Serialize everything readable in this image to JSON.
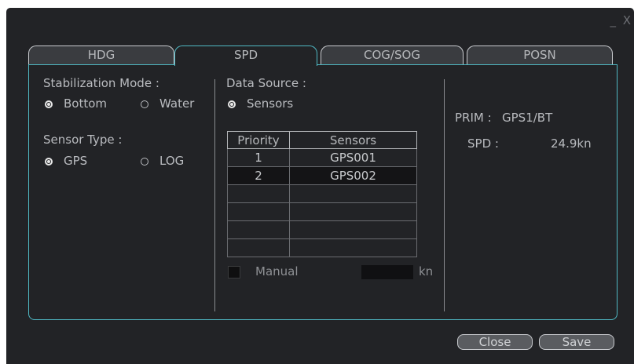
{
  "window": {
    "controls": "_ X"
  },
  "tabs": [
    {
      "label": "HDG",
      "active": false
    },
    {
      "label": "SPD",
      "active": true
    },
    {
      "label": "COG/SOG",
      "active": false
    },
    {
      "label": "POSN",
      "active": false
    }
  ],
  "stabilization": {
    "label": "Stabilization Mode :",
    "options": [
      {
        "label": "Bottom",
        "selected": true
      },
      {
        "label": "Water",
        "selected": false
      }
    ]
  },
  "sensor_type": {
    "label": "Sensor Type :",
    "options": [
      {
        "label": "GPS",
        "selected": true
      },
      {
        "label": "LOG",
        "selected": false
      }
    ]
  },
  "data_source": {
    "label": "Data Source :",
    "sensors_option": {
      "label": "Sensors",
      "selected": true
    },
    "table": {
      "headers": [
        "Priority",
        "Sensors"
      ],
      "rows": [
        [
          "1",
          "GPS001"
        ],
        [
          "2",
          "GPS002"
        ],
        [
          "",
          ""
        ],
        [
          "",
          ""
        ],
        [
          "",
          ""
        ],
        [
          "",
          ""
        ]
      ],
      "selected_row_index": 1
    },
    "manual": {
      "label": "Manual",
      "checked": false,
      "value": "",
      "unit": "kn"
    }
  },
  "status": {
    "prim_label": "PRIM :",
    "prim_value": "GPS1/BT",
    "spd_label": "SPD :",
    "spd_value": "24.9kn"
  },
  "buttons": {
    "close": "Close",
    "save": "Save"
  },
  "colors": {
    "accent": "#4fb8c3",
    "background": "#222326"
  }
}
